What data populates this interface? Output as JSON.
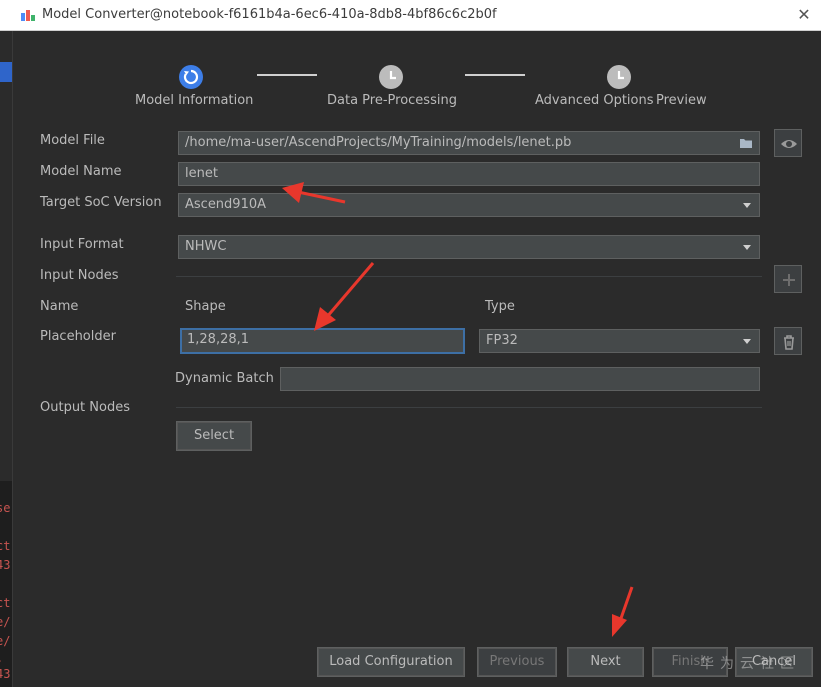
{
  "window": {
    "title": "Model Converter@notebook-f6161b4a-6ec6-410a-8db8-4bf86c6c2b0f",
    "close_glyph": "✕"
  },
  "left_strip": {
    "lines": [
      "se",
      "ct",
      "43",
      "ct",
      "e/",
      "e/",
      ".",
      "43"
    ]
  },
  "steps": [
    {
      "label": "Model Information",
      "state": "active"
    },
    {
      "label": "Data Pre-Processing",
      "state": "pending"
    },
    {
      "label": "Advanced Options",
      "state": "pending"
    },
    {
      "label": "Preview",
      "state": "pending"
    }
  ],
  "form": {
    "model_file": {
      "label": "Model File",
      "value": "/home/ma-user/AscendProjects/MyTraining/models/lenet.pb"
    },
    "model_name": {
      "label": "Model Name",
      "value": "lenet"
    },
    "target_soc": {
      "label": "Target SoC Version",
      "value": "Ascend910A"
    },
    "input_format": {
      "label": "Input Format",
      "value": "NHWC"
    },
    "input_nodes": {
      "label": "Input Nodes"
    },
    "name_header": "Name",
    "shape_header": "Shape",
    "type_header": "Type",
    "node": {
      "name": "Placeholder",
      "shape": "1,28,28,1",
      "type": "FP32"
    },
    "dynamic_batch": {
      "label": "Dynamic Batch",
      "value": ""
    },
    "output_nodes": {
      "label": "Output Nodes",
      "select_label": "Select"
    }
  },
  "footer": {
    "load_config": "Load Configuration",
    "previous": "Previous",
    "next": "Next",
    "finish": "Finish",
    "cancel": "Cancel"
  },
  "watermark": "华为云社区",
  "colors": {
    "accent": "#3d7ee8",
    "annotation": "#e8372c"
  }
}
